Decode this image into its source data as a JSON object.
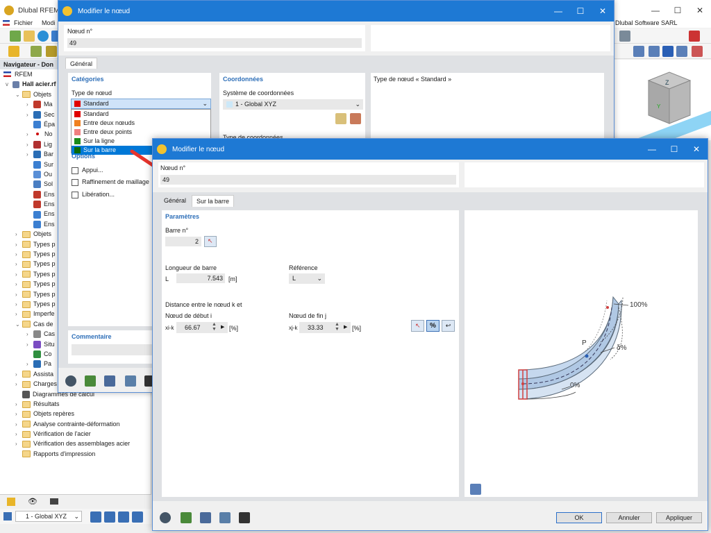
{
  "main_title": "Dlubal RFEM |",
  "menu": {
    "fichier": "Fichier",
    "modif": "Modi",
    "company": "Dlubal Software SARL"
  },
  "navigator": {
    "header": "Navigateur - Don",
    "root": "RFEM",
    "project": "Hall acier.rf",
    "items": [
      {
        "label": "Objets",
        "level": 1,
        "exp": "v",
        "type": "folder"
      },
      {
        "label": "Ma",
        "level": 2,
        "exp": ">",
        "type": "icon",
        "color": "#c0392b"
      },
      {
        "label": "Sec",
        "level": 2,
        "exp": ">",
        "type": "icon",
        "color": "#2a6db5"
      },
      {
        "label": "Épa",
        "level": 2,
        "exp": "",
        "type": "icon",
        "color": "#3b7fd1"
      },
      {
        "label": "No",
        "level": 2,
        "exp": ">",
        "type": "dot",
        "color": "#c00"
      },
      {
        "label": "Lig",
        "level": 2,
        "exp": ">",
        "type": "icon",
        "color": "#b03030"
      },
      {
        "label": "Bar",
        "level": 2,
        "exp": ">",
        "type": "icon",
        "color": "#2a6db5"
      },
      {
        "label": "Sur",
        "level": 2,
        "exp": "",
        "type": "icon",
        "color": "#3b7fd1"
      },
      {
        "label": "Ou",
        "level": 2,
        "exp": "",
        "type": "icon",
        "color": "#5a8fd6"
      },
      {
        "label": "Sol",
        "level": 2,
        "exp": "",
        "type": "icon",
        "color": "#4a7ec2"
      },
      {
        "label": "Ens",
        "level": 2,
        "exp": "",
        "type": "icon",
        "color": "#c0392b"
      },
      {
        "label": "Ens",
        "level": 2,
        "exp": "",
        "type": "icon",
        "color": "#c0392b"
      },
      {
        "label": "Ens",
        "level": 2,
        "exp": "",
        "type": "icon",
        "color": "#3b7fd1"
      },
      {
        "label": "Ens",
        "level": 2,
        "exp": "",
        "type": "icon",
        "color": "#3b7fd1"
      },
      {
        "label": "Objets",
        "level": 1,
        "exp": ">",
        "type": "folder"
      },
      {
        "label": "Types p",
        "level": 1,
        "exp": ">",
        "type": "folder"
      },
      {
        "label": "Types p",
        "level": 1,
        "exp": ">",
        "type": "folder"
      },
      {
        "label": "Types p",
        "level": 1,
        "exp": ">",
        "type": "folder"
      },
      {
        "label": "Types p",
        "level": 1,
        "exp": ">",
        "type": "folder"
      },
      {
        "label": "Types p",
        "level": 1,
        "exp": ">",
        "type": "folder"
      },
      {
        "label": "Types p",
        "level": 1,
        "exp": ">",
        "type": "folder"
      },
      {
        "label": "Types p",
        "level": 1,
        "exp": ">",
        "type": "folder"
      },
      {
        "label": "Imperfe",
        "level": 1,
        "exp": ">",
        "type": "folder"
      },
      {
        "label": "Cas de",
        "level": 1,
        "exp": "v",
        "type": "folder"
      },
      {
        "label": "Cas",
        "level": 2,
        "exp": ">",
        "type": "icon",
        "color": "#888"
      },
      {
        "label": "Situ",
        "level": 2,
        "exp": ">",
        "type": "icon",
        "color": "#7a4cc2"
      },
      {
        "label": "Co",
        "level": 2,
        "exp": "",
        "type": "icon",
        "color": "#2f8f3f"
      },
      {
        "label": "Pa",
        "level": 2,
        "exp": ">",
        "type": "icon",
        "color": "#2a6db5"
      },
      {
        "label": "Assista",
        "level": 1,
        "exp": ">",
        "type": "folder"
      },
      {
        "label": "Charges",
        "level": 1,
        "exp": ">",
        "type": "folder"
      },
      {
        "label": "Diagrammes de calcul",
        "level": 1,
        "exp": "",
        "type": "icon",
        "color": "#555"
      },
      {
        "label": "Résultats",
        "level": 1,
        "exp": ">",
        "type": "folder"
      },
      {
        "label": "Objets repères",
        "level": 1,
        "exp": ">",
        "type": "folder"
      },
      {
        "label": "Analyse contrainte-déformation",
        "level": 1,
        "exp": ">",
        "type": "folder"
      },
      {
        "label": "Vérification de l'acier",
        "level": 1,
        "exp": ">",
        "type": "folder"
      },
      {
        "label": "Vérification des assemblages acier",
        "level": 1,
        "exp": ">",
        "type": "folder"
      },
      {
        "label": "Rapports d'impression",
        "level": 1,
        "exp": "",
        "type": "folder"
      }
    ]
  },
  "statusbar": {
    "coord": "1 - Global XYZ"
  },
  "dialog1": {
    "title": "Modifier le nœud",
    "node_label": "Nœud n°",
    "node_value": "49",
    "tab_general": "Général",
    "categories": "Catégories",
    "type_label": "Type de nœud",
    "type_value": "Standard",
    "dropdown": [
      {
        "label": "Standard",
        "color": "#e00000"
      },
      {
        "label": "Entre deux nœuds",
        "color": "#f08020"
      },
      {
        "label": "Entre deux points",
        "color": "#f08080"
      },
      {
        "label": "Sur la ligne",
        "color": "#1a8a1a"
      },
      {
        "label": "Sur la barre",
        "color": "#0a6a0a"
      }
    ],
    "options": "Options",
    "cb_appui": "Appui...",
    "cb_raff": "Raffinement de maillage",
    "cb_lib": "Libération...",
    "coords": "Coordonnées",
    "coord_sys_label": "Système de coordonnées",
    "coord_sys_value": "1 - Global XYZ",
    "coord_type_label": "Type de coordonnées",
    "desc": "Type de nœud « Standard »",
    "comment": "Commentaire"
  },
  "dialog2": {
    "title": "Modifier le nœud",
    "node_label": "Nœud n°",
    "node_value": "49",
    "tab_general": "Général",
    "tab_barre": "Sur la barre",
    "parametres": "Paramètres",
    "barre_label": "Barre n°",
    "barre_value": "2",
    "longueur_label": "Longueur de barre",
    "L": "L",
    "L_value": "7.543",
    "L_unit": "[m]",
    "reference_label": "Référence",
    "reference_value": "L",
    "distance_label": "Distance entre le nœud k et",
    "debut_label": "Nœud de début i",
    "fin_label": "Nœud de fin j",
    "xik": "xi-k",
    "xik_value": "66.67",
    "xjk": "xj-k",
    "xjk_value": "33.33",
    "pct": "[%]",
    "pct_btn": "%",
    "fig_100": "100%",
    "fig_d": "δ%",
    "fig_0": "0%",
    "fig_P": "P",
    "ok": "OK",
    "annuler": "Annuler",
    "appliquer": "Appliquer"
  }
}
